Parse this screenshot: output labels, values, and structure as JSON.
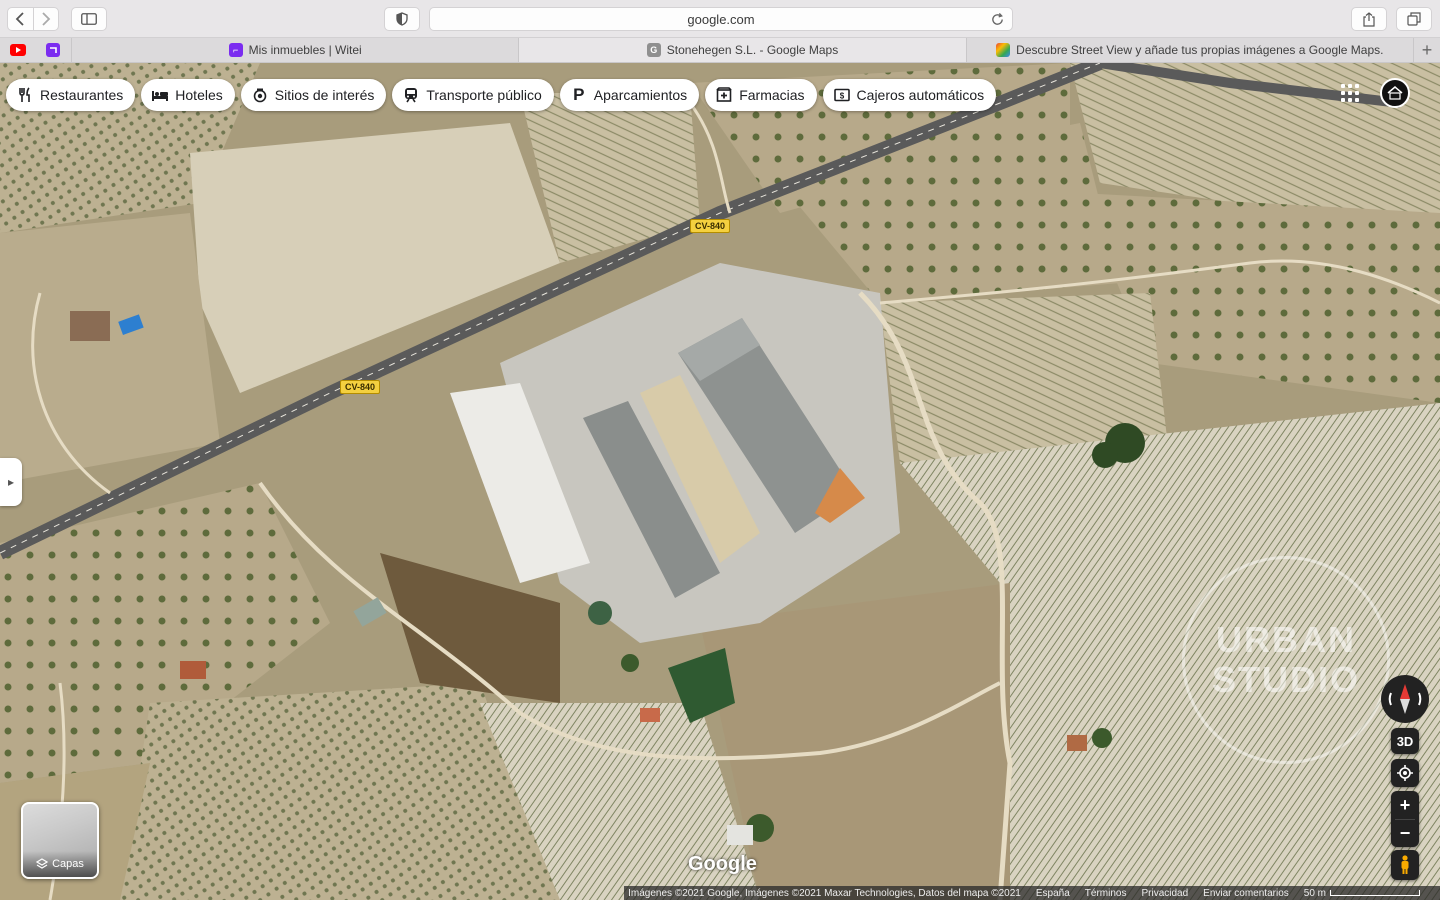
{
  "browser": {
    "url": "google.com",
    "tabs": [
      {
        "title": "Mis inmuebles | Witei",
        "favicon_color": "#7b2cf0",
        "active": false
      },
      {
        "title": "Stonehegen S.L. - Google Maps",
        "favicon_color": "#8f8f8f",
        "active": true
      },
      {
        "title": "Descubre Street View y añade tus propias imágenes a Google Maps.",
        "favicon_color": "#34a853",
        "active": false
      }
    ],
    "pinned": [
      "youtube-icon",
      "witei-icon"
    ]
  },
  "map": {
    "categories": [
      {
        "label": "Restaurantes",
        "icon": "fork-knife-icon"
      },
      {
        "label": "Hoteles",
        "icon": "bed-icon"
      },
      {
        "label": "Sitios de interés",
        "icon": "camera-icon"
      },
      {
        "label": "Transporte público",
        "icon": "train-icon"
      },
      {
        "label": "Aparcamientos",
        "icon": "parking-icon"
      },
      {
        "label": "Farmacias",
        "icon": "pharmacy-icon"
      },
      {
        "label": "Cajeros automáticos",
        "icon": "atm-icon"
      }
    ],
    "road_label": "CV-840",
    "layers_label": "Capas",
    "logo": "Google",
    "watermark_line1": "URBAN",
    "watermark_line2": "STUDIO",
    "controls": {
      "three_d": "3D",
      "zoom_in": "+",
      "zoom_out": "−"
    },
    "attribution": {
      "imagery": "Imágenes ©2021 Google, Imágenes ©2021 Maxar Technologies, Datos del mapa ©2021",
      "country": "España",
      "terms": "Términos",
      "privacy": "Privacidad",
      "feedback": "Enviar comentarios",
      "scale": "50 m"
    }
  }
}
